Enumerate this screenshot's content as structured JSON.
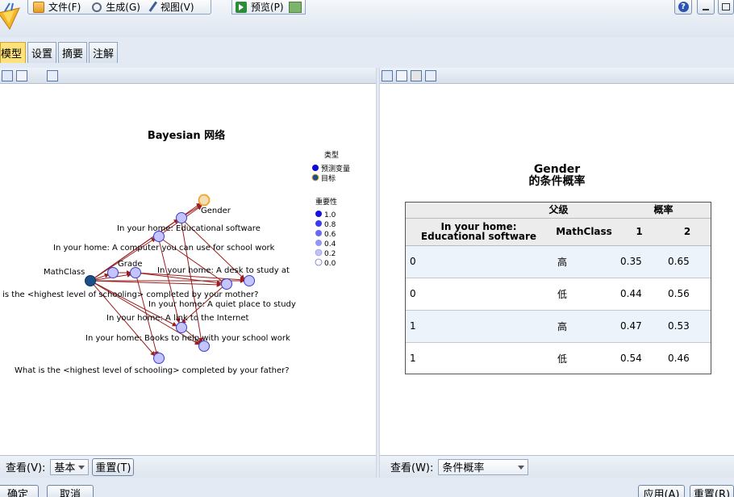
{
  "menu": {
    "file": "文件(F)",
    "generate": "生成(G)",
    "view": "视图(V)",
    "preview": "预览(P)"
  },
  "tabs": [
    "模型",
    "设置",
    "摘要",
    "注解"
  ],
  "network": {
    "title": "Bayesian 网络",
    "nodes": {
      "gender": "Gender",
      "edu_software": "In your home: Educational software",
      "computer": "In your home: A computer you can use for school work",
      "grade": "Grade",
      "mathclass": "MathClass",
      "desk": "In your home: A desk to study at",
      "mother": "t is the <highest level of schooling> completed by your mother?",
      "quiet": "In your home: A quiet place to study",
      "internet": "In your home: A link to the Internet",
      "books": "In your home: Books to help with your school work",
      "father": "What is the <highest level of schooling> completed by your father?"
    },
    "legend": {
      "type_title": "类型",
      "type_items": [
        "预测变量",
        "目标"
      ],
      "importance_title": "重要性",
      "importance_items": [
        "1.0",
        "0.8",
        "0.6",
        "0.4",
        "0.2",
        "0.0"
      ]
    }
  },
  "left_bottom": {
    "view_label": "查看(V):",
    "view_value": "基本",
    "reset_label": "重置(T)"
  },
  "prob": {
    "title_line1": "Gender",
    "title_line2": "的条件概率",
    "parents_header": "父级",
    "prob_header": "概率",
    "col1": "In your home: Educational software",
    "col2": "MathClass",
    "col3": "1",
    "col4": "2",
    "rows": [
      [
        "0",
        "高",
        "0.35",
        "0.65"
      ],
      [
        "0",
        "低",
        "0.44",
        "0.56"
      ],
      [
        "1",
        "高",
        "0.47",
        "0.53"
      ],
      [
        "1",
        "低",
        "0.54",
        "0.46"
      ]
    ]
  },
  "right_bottom": {
    "view_label": "查看(W):",
    "view_value": "条件概率"
  },
  "footer": {
    "ok": "确定",
    "cancel": "取消",
    "apply": "应用(A)",
    "reset": "重置(R)"
  },
  "colors": {
    "accent": "#ffe37a",
    "node_fill": "#c4c4ff",
    "predictor": "#0a0ad8",
    "target": "#1a4f8a",
    "target_ring": "#f2a93a",
    "edge": "#9b1f1f"
  }
}
